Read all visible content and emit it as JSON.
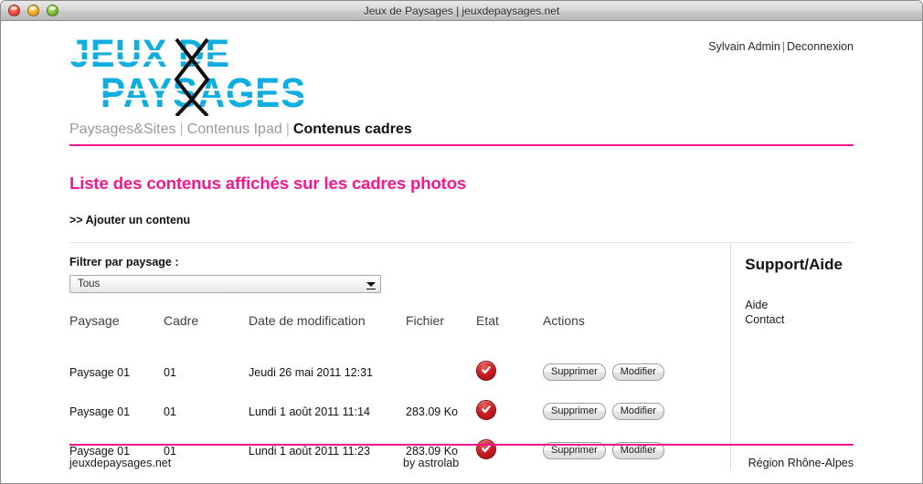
{
  "window": {
    "title": "Jeux de Paysages | jeuxdepaysages.net",
    "controls": {
      "close": "close-button",
      "minimize": "minimize-button",
      "zoom": "zoom-button"
    }
  },
  "theme": {
    "accent_pink": "#f5188c",
    "logo_blue": "#0fade0",
    "status_red": "#cf1f25"
  },
  "header": {
    "logo": {
      "line1": "JEUX DE",
      "line2": "PAYSAGES",
      "alt": "Jeux de Paysages"
    },
    "user": {
      "name": "Sylvain Admin",
      "separator": "|",
      "logout": "Deconnexion"
    }
  },
  "nav": {
    "items": [
      {
        "label": "Paysages&Sites",
        "active": false
      },
      {
        "label": "Contenus Ipad",
        "active": false
      },
      {
        "label": "Contenus cadres",
        "active": true
      }
    ],
    "divider": "|"
  },
  "main": {
    "title": "Liste des contenus affichés sur les cadres photos",
    "add_link": ">> Ajouter un contenu",
    "filter": {
      "label": "Filtrer par paysage :",
      "value": "Tous",
      "options": [
        "Tous"
      ]
    },
    "table": {
      "headers": [
        "Paysage",
        "Cadre",
        "Date de modification",
        "Fichier",
        "Etat",
        "Actions"
      ],
      "rows": [
        {
          "paysage": "Paysage 01",
          "cadre": "01",
          "date": "Jeudi 26 mai 2011 12:31",
          "fichier": "",
          "etat": "valide",
          "actions": [
            "Supprimer",
            "Modifier"
          ]
        },
        {
          "paysage": "Paysage 01",
          "cadre": "01",
          "date": "Lundi 1 août 2011 11:14",
          "fichier": "283.09 Ko",
          "etat": "valide",
          "actions": [
            "Supprimer",
            "Modifier"
          ]
        },
        {
          "paysage": "Paysage 01",
          "cadre": "01",
          "date": "Lundi 1 août 2011 11:23",
          "fichier": "283.09 Ko",
          "etat": "valide",
          "actions": [
            "Supprimer",
            "Modifier"
          ]
        }
      ]
    }
  },
  "sidebar": {
    "title": "Support/Aide",
    "links": [
      {
        "label": "Aide"
      },
      {
        "label": "Contact"
      }
    ]
  },
  "footer": {
    "left": "jeuxdepaysages.net",
    "center": "by astrolab",
    "right": "Région Rhône-Alpes"
  }
}
